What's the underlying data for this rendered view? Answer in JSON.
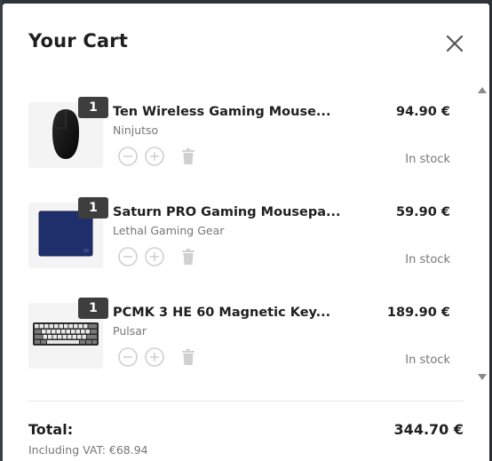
{
  "cart": {
    "title": "Your Cart",
    "close_icon": "close-icon"
  },
  "items": [
    {
      "quantity": "1",
      "name": "Ten Wireless Gaming Mouse...",
      "brand": "Ninjutso",
      "price": "94.90 €",
      "stock": "In stock",
      "image": "mouse-image"
    },
    {
      "quantity": "1",
      "name": "Saturn PRO Gaming Mousepa...",
      "brand": "Lethal Gaming Gear",
      "price": "59.90 €",
      "stock": "In stock",
      "image": "mousepad-image"
    },
    {
      "quantity": "1",
      "name": "PCMK 3 HE 60 Magnetic Key...",
      "brand": "Pulsar",
      "price": "189.90 €",
      "stock": "In stock",
      "image": "keyboard-image"
    }
  ],
  "icons": {
    "decrease": "minus-circle-icon",
    "increase": "plus-circle-icon",
    "remove": "trash-icon"
  },
  "colors": {
    "text": "#1f1f1f",
    "muted": "#777777",
    "badge": "#3e3e3e",
    "disabled_icon": "#d0d0d0",
    "thumb_bg": "#f4f4f4"
  },
  "footer": {
    "total_label": "Total:",
    "total_value": "344.70 €",
    "vat_text": "Including VAT: €68.94"
  }
}
